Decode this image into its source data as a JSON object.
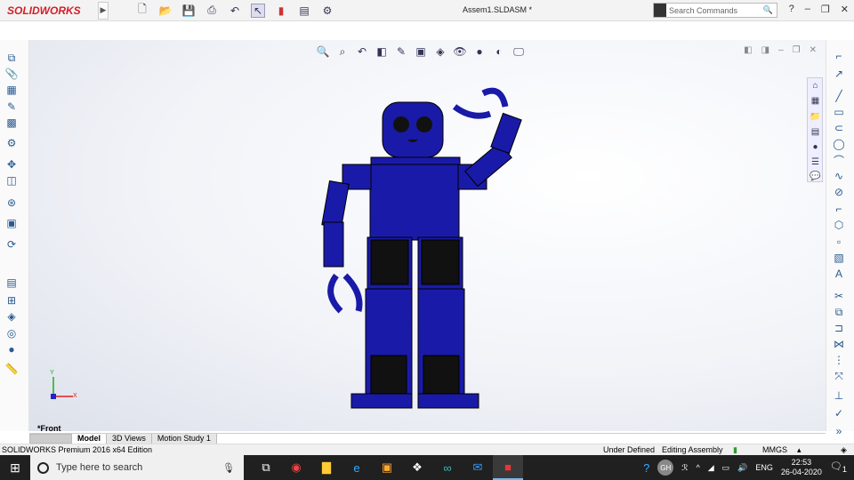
{
  "app": {
    "logo": "SOLIDWORKS",
    "title": "Assem1.SLDASM *",
    "search_placeholder": "Search Commands"
  },
  "toolbar": {
    "icons": [
      "new-icon",
      "open-icon",
      "save-icon",
      "print-icon",
      "undo-icon",
      "select-icon",
      "rebuild-icon",
      "file-properties-icon",
      "options-icon"
    ]
  },
  "window": {
    "help": "?",
    "minimize": "–",
    "restore": "❐",
    "close": "✕"
  },
  "viewport": {
    "view_name": "*Front",
    "triad": {
      "y": "Y",
      "x": "X"
    },
    "model_color": "#1a1aa8"
  },
  "tabs": [
    {
      "label": "Model",
      "active": true
    },
    {
      "label": "3D Views"
    },
    {
      "label": "Motion Study 1"
    }
  ],
  "status": {
    "edition": "SOLIDWORKS Premium 2016 x64 Edition",
    "definition": "Under Defined",
    "mode": "Editing Assembly",
    "units": "MMGS"
  },
  "taskbar": {
    "search_placeholder": "Type here to search",
    "avatar": "GH",
    "lang": "ENG",
    "time": "22:53",
    "date": "26-04-2020",
    "notifications": "1"
  }
}
